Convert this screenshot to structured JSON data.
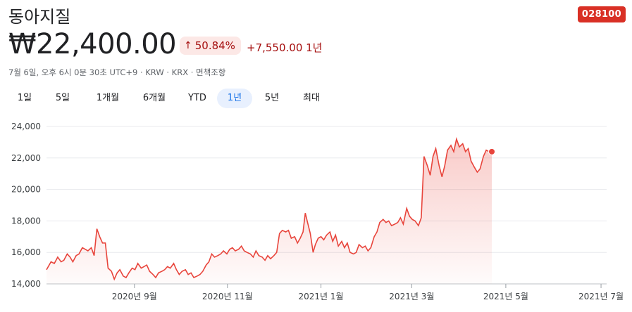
{
  "header": {
    "title": "동아지질",
    "ticker": "028100",
    "price": "₩22,400.00",
    "percent_change": "50.84%",
    "change_text": "+7,550.00 1년",
    "meta": "7월 6일, 오후 6시 0분 30초 UTC+9 · KRW · KRX · 면책조항"
  },
  "tabs": [
    {
      "label": "1일",
      "active": false
    },
    {
      "label": "5일",
      "active": false
    },
    {
      "label": "1개월",
      "active": false
    },
    {
      "label": "6개월",
      "active": false
    },
    {
      "label": "YTD",
      "active": false
    },
    {
      "label": "1년",
      "active": true
    },
    {
      "label": "5년",
      "active": false
    },
    {
      "label": "최대",
      "active": false
    }
  ],
  "colors": {
    "line": "#e8453c",
    "accent_badge": "#d93025",
    "active_tab": "#1a73e8"
  },
  "chart_data": {
    "type": "area",
    "ylim": [
      14000,
      24000
    ],
    "y_ticks": [
      14000,
      16000,
      18000,
      20000,
      22000,
      24000
    ],
    "y_tick_labels": [
      "14,000",
      "16,000",
      "18,000",
      "20,000",
      "22,000",
      "24,000"
    ],
    "x_tick_labels": [
      {
        "label": "2020년 9월",
        "x": 2020.667
      },
      {
        "label": "2020년 11월",
        "x": 2020.833
      },
      {
        "label": "2021년 1월",
        "x": 2021.0
      },
      {
        "label": "2021년 3월",
        "x": 2021.162
      },
      {
        "label": "2021년 5월",
        "x": 2021.33
      },
      {
        "label": "2021년 7월",
        "x": 2021.5
      }
    ],
    "x_range": [
      2020.51,
      2021.51
    ],
    "grid": true,
    "series": [
      {
        "values": [
          [
            2020.51,
            14900
          ],
          [
            2020.518,
            15400
          ],
          [
            2020.524,
            15300
          ],
          [
            2020.53,
            15700
          ],
          [
            2020.536,
            15400
          ],
          [
            2020.541,
            15500
          ],
          [
            2020.547,
            15900
          ],
          [
            2020.552,
            15700
          ],
          [
            2020.557,
            15400
          ],
          [
            2020.563,
            15800
          ],
          [
            2020.568,
            15900
          ],
          [
            2020.574,
            16300
          ],
          [
            2020.579,
            16200
          ],
          [
            2020.584,
            16100
          ],
          [
            2020.59,
            16300
          ],
          [
            2020.595,
            15800
          ],
          [
            2020.6,
            17500
          ],
          [
            2020.605,
            17000
          ],
          [
            2020.61,
            16600
          ],
          [
            2020.615,
            16600
          ],
          [
            2020.62,
            15000
          ],
          [
            2020.626,
            14800
          ],
          [
            2020.631,
            14300
          ],
          [
            2020.636,
            14700
          ],
          [
            2020.641,
            14900
          ],
          [
            2020.647,
            14500
          ],
          [
            2020.652,
            14400
          ],
          [
            2020.657,
            14700
          ],
          [
            2020.663,
            15000
          ],
          [
            2020.668,
            14900
          ],
          [
            2020.673,
            15300
          ],
          [
            2020.679,
            15000
          ],
          [
            2020.684,
            15100
          ],
          [
            2020.689,
            15200
          ],
          [
            2020.694,
            14800
          ],
          [
            2020.7,
            14600
          ],
          [
            2020.705,
            14400
          ],
          [
            2020.71,
            14700
          ],
          [
            2020.716,
            14800
          ],
          [
            2020.721,
            14900
          ],
          [
            2020.726,
            15100
          ],
          [
            2020.731,
            15000
          ],
          [
            2020.737,
            15300
          ],
          [
            2020.742,
            14900
          ],
          [
            2020.747,
            14600
          ],
          [
            2020.752,
            14800
          ],
          [
            2020.758,
            14900
          ],
          [
            2020.763,
            14600
          ],
          [
            2020.768,
            14700
          ],
          [
            2020.773,
            14400
          ],
          [
            2020.779,
            14500
          ],
          [
            2020.784,
            14600
          ],
          [
            2020.789,
            14800
          ],
          [
            2020.795,
            15200
          ],
          [
            2020.8,
            15400
          ],
          [
            2020.805,
            15900
          ],
          [
            2020.81,
            15700
          ],
          [
            2020.816,
            15800
          ],
          [
            2020.821,
            15900
          ],
          [
            2020.826,
            16100
          ],
          [
            2020.832,
            15900
          ],
          [
            2020.837,
            16200
          ],
          [
            2020.842,
            16300
          ],
          [
            2020.847,
            16100
          ],
          [
            2020.853,
            16200
          ],
          [
            2020.858,
            16400
          ],
          [
            2020.863,
            16100
          ],
          [
            2020.868,
            16000
          ],
          [
            2020.874,
            15900
          ],
          [
            2020.879,
            15700
          ],
          [
            2020.884,
            16100
          ],
          [
            2020.889,
            15800
          ],
          [
            2020.895,
            15700
          ],
          [
            2020.9,
            15500
          ],
          [
            2020.905,
            15800
          ],
          [
            2020.91,
            15600
          ],
          [
            2020.916,
            15800
          ],
          [
            2020.921,
            16000
          ],
          [
            2020.926,
            17200
          ],
          [
            2020.931,
            17400
          ],
          [
            2020.937,
            17300
          ],
          [
            2020.942,
            17400
          ],
          [
            2020.947,
            16900
          ],
          [
            2020.953,
            17000
          ],
          [
            2020.958,
            16600
          ],
          [
            2020.963,
            16900
          ],
          [
            2020.968,
            17300
          ],
          [
            2020.972,
            18500
          ],
          [
            2020.976,
            17900
          ],
          [
            2020.981,
            17200
          ],
          [
            2020.986,
            16000
          ],
          [
            2020.99,
            16500
          ],
          [
            2020.995,
            16900
          ],
          [
            2021.0,
            17000
          ],
          [
            2021.005,
            16800
          ],
          [
            2021.01,
            17100
          ],
          [
            2021.016,
            17300
          ],
          [
            2021.021,
            16700
          ],
          [
            2021.026,
            17100
          ],
          [
            2021.031,
            16400
          ],
          [
            2021.037,
            16700
          ],
          [
            2021.042,
            16300
          ],
          [
            2021.047,
            16600
          ],
          [
            2021.052,
            16000
          ],
          [
            2021.058,
            15900
          ],
          [
            2021.063,
            16000
          ],
          [
            2021.068,
            16500
          ],
          [
            2021.074,
            16300
          ],
          [
            2021.079,
            16400
          ],
          [
            2021.084,
            16100
          ],
          [
            2021.089,
            16300
          ],
          [
            2021.095,
            17000
          ],
          [
            2021.1,
            17300
          ],
          [
            2021.105,
            17900
          ],
          [
            2021.111,
            18100
          ],
          [
            2021.116,
            17900
          ],
          [
            2021.121,
            18000
          ],
          [
            2021.126,
            17700
          ],
          [
            2021.132,
            17800
          ],
          [
            2021.137,
            17900
          ],
          [
            2021.142,
            18200
          ],
          [
            2021.147,
            17800
          ],
          [
            2021.153,
            18800
          ],
          [
            2021.158,
            18300
          ],
          [
            2021.163,
            18100
          ],
          [
            2021.168,
            18000
          ],
          [
            2021.174,
            17700
          ],
          [
            2021.179,
            18200
          ],
          [
            2021.184,
            22100
          ],
          [
            2021.19,
            21500
          ],
          [
            2021.195,
            20900
          ],
          [
            2021.2,
            22100
          ],
          [
            2021.205,
            22600
          ],
          [
            2021.211,
            21500
          ],
          [
            2021.216,
            20800
          ],
          [
            2021.221,
            21500
          ],
          [
            2021.226,
            22500
          ],
          [
            2021.232,
            22800
          ],
          [
            2021.237,
            22400
          ],
          [
            2021.242,
            23200
          ],
          [
            2021.247,
            22700
          ],
          [
            2021.253,
            22900
          ],
          [
            2021.258,
            22400
          ],
          [
            2021.263,
            22600
          ],
          [
            2021.268,
            21800
          ],
          [
            2021.274,
            21400
          ],
          [
            2021.279,
            21100
          ],
          [
            2021.284,
            21300
          ],
          [
            2021.29,
            22100
          ],
          [
            2021.295,
            22500
          ],
          [
            2021.3,
            22400
          ],
          [
            2021.305,
            22400
          ]
        ]
      }
    ]
  }
}
